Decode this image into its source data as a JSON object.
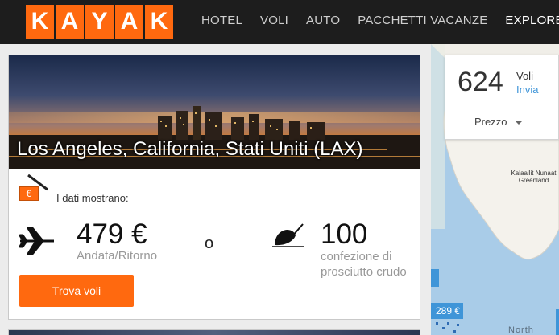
{
  "header": {
    "logo_letters": [
      "K",
      "A",
      "Y",
      "A",
      "K"
    ],
    "nav": [
      {
        "label": "HOTEL",
        "active": false
      },
      {
        "label": "VOLI",
        "active": false
      },
      {
        "label": "AUTO",
        "active": false
      },
      {
        "label": "PACCHETTI VACANZE",
        "active": false
      },
      {
        "label": "EXPLORE",
        "active": true
      }
    ],
    "brand_color": "#ff690f"
  },
  "destination_card": {
    "title": "Los Angeles, California, Stati Uniti (LAX)",
    "currency_tag": "€",
    "data_label": "I dati mostrano:",
    "price": "479 €",
    "price_sub": "Andata/Ritorno",
    "or": "o",
    "alt_qty": "100",
    "alt_sub": "confezione di prosciutto crudo",
    "button_label": "Trova voli",
    "icons": {
      "plane": "plane-icon",
      "ham": "ham-icon",
      "tag": "currency-tag-icon"
    }
  },
  "map": {
    "region_label": "Kalaallit Nunaat Greenland",
    "ocean_label": "North",
    "price_chip": "289 €",
    "water_color": "#a9cce8"
  },
  "flights_box": {
    "count": "624",
    "unit": "Voli",
    "action": "Invia",
    "sort_label": "Prezzo"
  }
}
